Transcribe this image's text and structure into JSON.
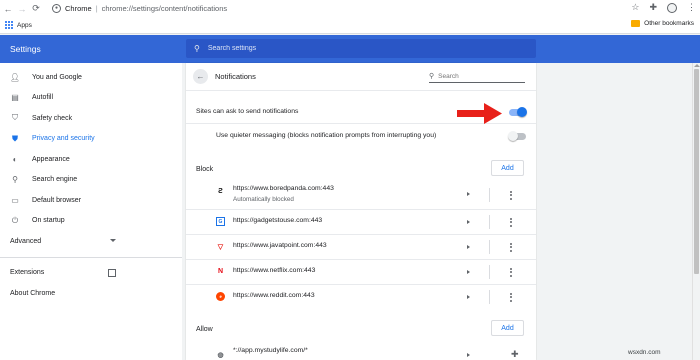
{
  "browser": {
    "host": "Chrome",
    "path": "chrome://settings/content/notifications",
    "bookmarks": {
      "apps_label": "Apps",
      "other_label": "Other bookmarks"
    }
  },
  "header": {
    "title": "Settings",
    "search_placeholder": "Search settings"
  },
  "sidebar": {
    "items": [
      {
        "label": "You and Google",
        "icon": "person-icon"
      },
      {
        "label": "Autofill",
        "icon": "clipboard-icon"
      },
      {
        "label": "Safety check",
        "icon": "shield-check-icon"
      },
      {
        "label": "Privacy and security",
        "icon": "shield-icon",
        "active": true
      },
      {
        "label": "Appearance",
        "icon": "palette-icon"
      },
      {
        "label": "Search engine",
        "icon": "search-icon"
      },
      {
        "label": "Default browser",
        "icon": "browser-icon"
      },
      {
        "label": "On startup",
        "icon": "power-icon"
      }
    ],
    "advanced": "Advanced",
    "extensions": "Extensions",
    "about": "About Chrome"
  },
  "panel": {
    "title": "Notifications",
    "search_placeholder": "Search",
    "ask_label": "Sites can ask to send notifications",
    "ask_enabled": true,
    "quieter_label": "Use quieter messaging (blocks notification prompts from interrupting you)",
    "quieter_enabled": false,
    "block_label": "Block",
    "allow_label": "Allow",
    "add_label": "Add",
    "blocked_sites": [
      {
        "url": "https://www.boredpanda.com:443",
        "sub": "Automatically blocked"
      },
      {
        "url": "https://gadgetstouse.com:443"
      },
      {
        "url": "https://www.javatpoint.com:443"
      },
      {
        "url": "https://www.netflix.com:443"
      },
      {
        "url": "https://www.reddit.com:443"
      }
    ],
    "allowed_sites": [
      {
        "url": "*://app.mystudylife.com/*"
      }
    ]
  },
  "colors": {
    "header_bg": "#3367d6",
    "accent": "#1a73e8",
    "arrow": "#e8201a"
  },
  "watermark": "wsxdn.com"
}
